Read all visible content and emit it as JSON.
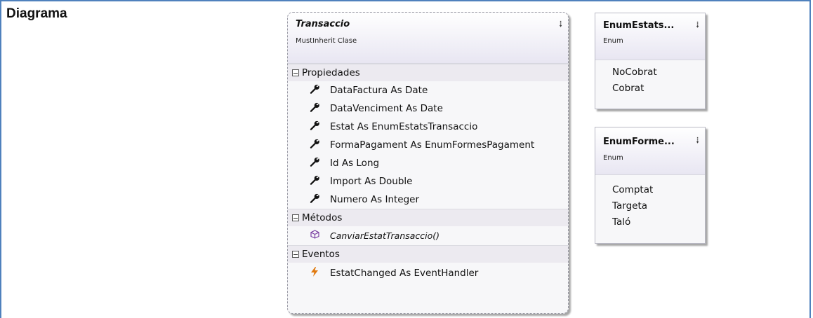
{
  "heading": "Diagrama",
  "transaccio": {
    "name": "Transaccio",
    "stereotype": "MustInherit Clase",
    "sections": {
      "properties": "Propiedades",
      "methods": "Métodos",
      "events": "Eventos"
    },
    "properties": [
      "DataFactura As Date",
      "DataVenciment As Date",
      "Estat As EnumEstatsTransaccio",
      "FormaPagament As EnumFormesPagament",
      "Id As Long",
      "Import As Double",
      "Numero As Integer"
    ],
    "methods": [
      "CanviarEstatTransaccio()"
    ],
    "events": [
      "EstatChanged As EventHandler"
    ]
  },
  "enum_estats": {
    "name": "EnumEstats...",
    "kind": "Enum",
    "values": [
      "NoCobrat",
      "Cobrat"
    ]
  },
  "enum_formes": {
    "name": "EnumForme...",
    "kind": "Enum",
    "values": [
      "Comptat",
      "Targeta",
      "Taló"
    ]
  },
  "icons": {
    "property": "wrench-icon",
    "method": "cube-icon",
    "event": "lightning-icon",
    "collapse": "double-chevron-up-icon"
  },
  "colors": {
    "frame_border": "#4f81bd",
    "header_gradient_end": "#e8e6f2",
    "method_icon": "#7a3fa3",
    "event_icon": "#e07a10"
  }
}
